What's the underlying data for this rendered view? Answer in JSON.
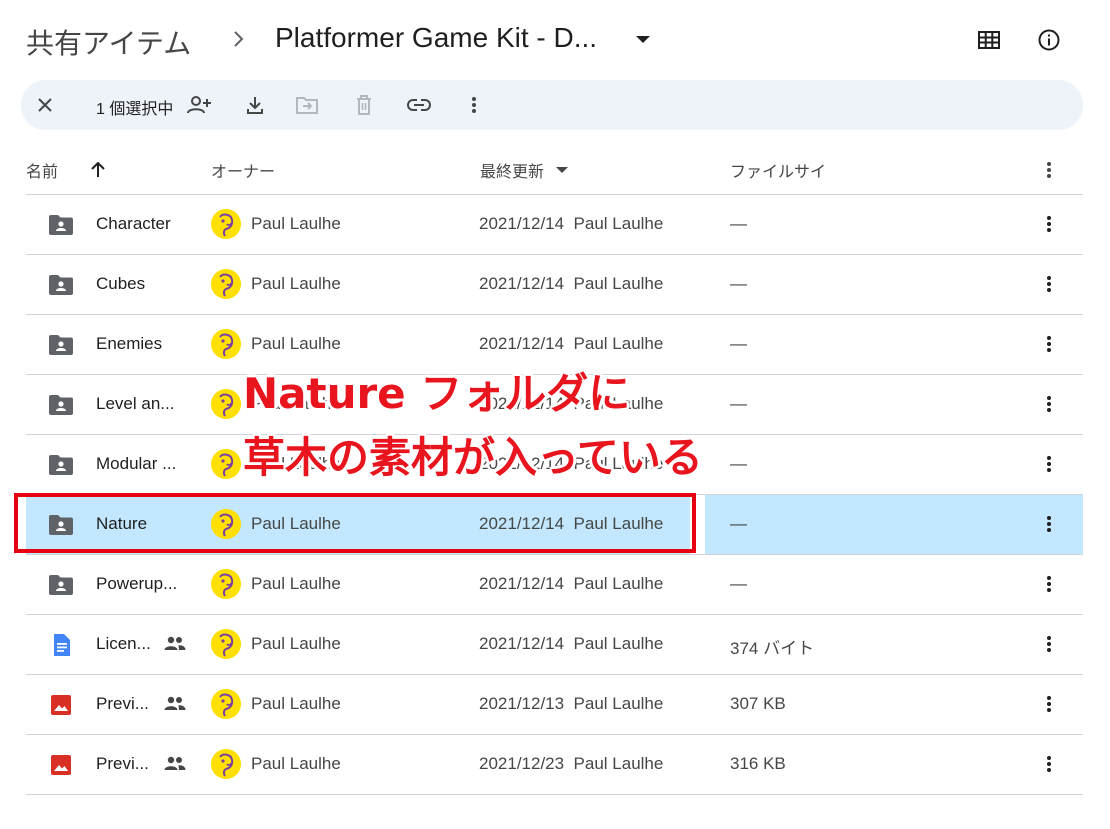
{
  "header": {
    "breadcrumb_root": "共有アイテム",
    "current_folder": "Platformer Game Kit - D...",
    "icons": [
      "grid-view-icon",
      "info-icon"
    ]
  },
  "selection_bar": {
    "count_label": "1 個選択中",
    "icons": [
      "close-icon",
      "share-person-add-icon",
      "download-icon",
      "move-folder-icon",
      "trash-icon",
      "link-icon",
      "more-vert-icon"
    ]
  },
  "columns": {
    "name": "名前",
    "owner": "オーナー",
    "modified": "最終更新",
    "size": "ファイルサイ"
  },
  "rows": [
    {
      "name": "Character",
      "type": "shared-folder",
      "owner": "Paul Laulhe",
      "modified": "2021/12/14",
      "modified_by": "Paul Laulhe",
      "size": "—",
      "selected": false,
      "shared": false
    },
    {
      "name": "Cubes",
      "type": "shared-folder",
      "owner": "Paul Laulhe",
      "modified": "2021/12/14",
      "modified_by": "Paul Laulhe",
      "size": "—",
      "selected": false,
      "shared": false
    },
    {
      "name": "Enemies",
      "type": "shared-folder",
      "owner": "Paul Laulhe",
      "modified": "2021/12/14",
      "modified_by": "Paul Laulhe",
      "size": "—",
      "selected": false,
      "shared": false
    },
    {
      "name": "Level an...",
      "type": "shared-folder",
      "owner": "Paul Laulhe",
      "modified": "2021/12/14",
      "modified_by": "Paul Laulhe",
      "size": "—",
      "selected": false,
      "shared": false
    },
    {
      "name": "Modular ...",
      "type": "shared-folder",
      "owner": "Paul Laulhe",
      "modified": "2021/12/14",
      "modified_by": "Paul Laulhe",
      "size": "—",
      "selected": false,
      "shared": false
    },
    {
      "name": "Nature",
      "type": "shared-folder",
      "owner": "Paul Laulhe",
      "modified": "2021/12/14",
      "modified_by": "Paul Laulhe",
      "size": "—",
      "selected": true,
      "shared": false
    },
    {
      "name": "Powerup...",
      "type": "shared-folder",
      "owner": "Paul Laulhe",
      "modified": "2021/12/14",
      "modified_by": "Paul Laulhe",
      "size": "—",
      "selected": false,
      "shared": false
    },
    {
      "name": "Licen...",
      "type": "doc",
      "owner": "Paul Laulhe",
      "modified": "2021/12/14",
      "modified_by": "Paul Laulhe",
      "size": "374 バイト",
      "selected": false,
      "shared": true
    },
    {
      "name": "Previ...",
      "type": "image",
      "owner": "Paul Laulhe",
      "modified": "2021/12/13",
      "modified_by": "Paul Laulhe",
      "size": "307 KB",
      "selected": false,
      "shared": true
    },
    {
      "name": "Previ...",
      "type": "image",
      "owner": "Paul Laulhe",
      "modified": "2021/12/23",
      "modified_by": "Paul Laulhe",
      "size": "316 KB",
      "selected": false,
      "shared": true
    }
  ],
  "annotation": {
    "line1": "Nature フォルダに",
    "line2": "草木の素材が入っている"
  },
  "colors": {
    "selected_row": "#c2e7ff",
    "selection_bar": "#eef2f9",
    "annotation_red": "#e60012",
    "folder_icon": "#5f6368",
    "doc_icon": "#4285f4",
    "image_icon": "#d93025",
    "avatar": "#ffe000"
  }
}
